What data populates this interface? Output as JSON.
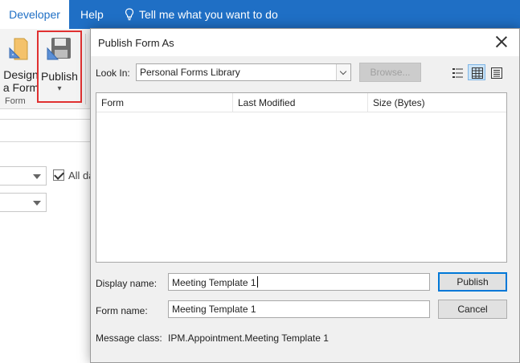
{
  "ribbon_tabs": {
    "developer": "Developer",
    "help": "Help",
    "tell_me": "Tell me what you want to do"
  },
  "ribbon": {
    "design_line1": "Design",
    "design_line2": "a Form",
    "publish_label": "Publish",
    "publish_arrow": "▾",
    "group_label": "Form"
  },
  "background": {
    "checkbox_label": "All da"
  },
  "dialog": {
    "title": "Publish Form As",
    "look_in_label": "Look In:",
    "look_in_value": "Personal Forms Library",
    "browse_button": "Browse...",
    "columns": [
      "Form",
      "Last Modified",
      "Size (Bytes)"
    ],
    "display_name_label": "Display name:",
    "display_name_value": "Meeting Template 1",
    "form_name_label": "Form name:",
    "form_name_value": "Meeting Template 1",
    "publish_button": "Publish",
    "cancel_button": "Cancel",
    "message_class_label": "Message class:",
    "message_class_value": "IPM.Appointment.Meeting Template 1"
  },
  "colors": {
    "ribbon_blue": "#1f6fc5",
    "highlight_red": "#e03030",
    "default_button_border": "#0078d7"
  }
}
